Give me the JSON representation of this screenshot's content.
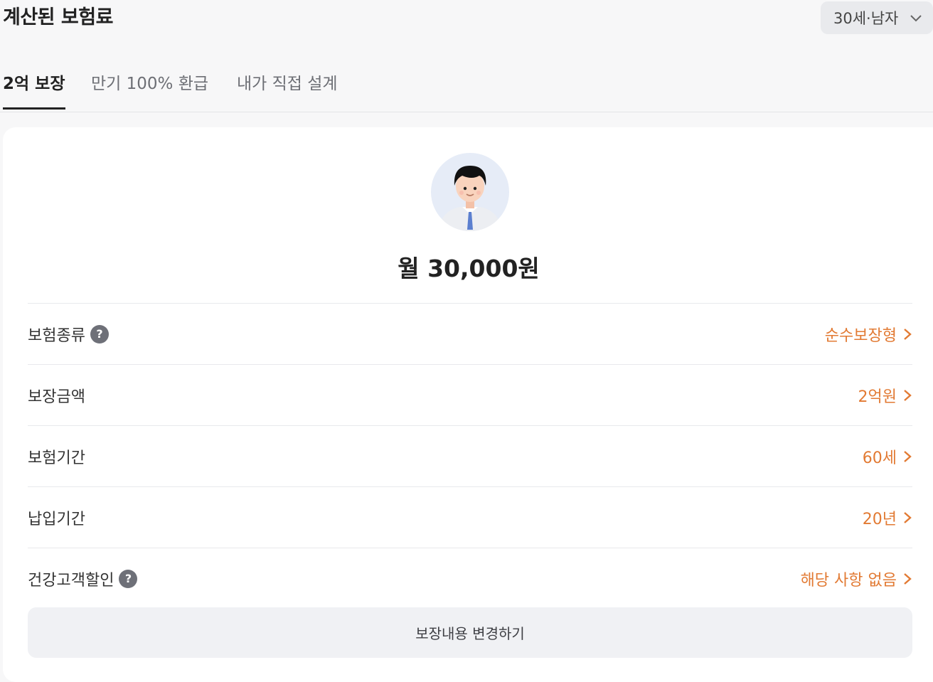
{
  "header": {
    "title": "계산된 보험료"
  },
  "age_select": {
    "value": "30세·남자",
    "icon": "chevron-down-icon"
  },
  "tabs": [
    {
      "label": "2억 보장",
      "active": true
    },
    {
      "label": "만기 100% 환급",
      "active": false
    },
    {
      "label": "내가 직접 설계",
      "active": false
    }
  ],
  "card": {
    "avatar": "person-avatar",
    "price": "월 30,000원",
    "rows": [
      {
        "label": "보험종류",
        "help": "?",
        "value": "순수보장형"
      },
      {
        "label": "보장금액",
        "value": "2억원"
      },
      {
        "label": "보험기간",
        "value": "60세"
      },
      {
        "label": "납입기간",
        "value": "20년"
      },
      {
        "label": "건강고객할인",
        "help": "?",
        "value": "해당 사항 없음"
      }
    ],
    "change_button": "보장내용 변경하기"
  },
  "colors": {
    "accent": "#e27a33",
    "background": "#f7f7f8",
    "button_bg": "#f0f1f4"
  }
}
